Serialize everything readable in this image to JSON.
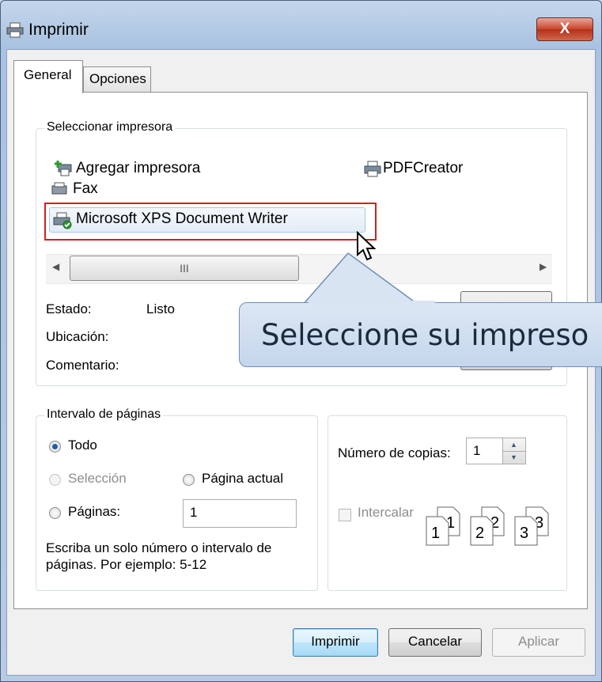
{
  "window": {
    "title": "Imprimir",
    "close_label": "X"
  },
  "tabs": [
    {
      "label": "General"
    },
    {
      "label": "Opciones"
    }
  ],
  "printer_group": {
    "label": "Seleccionar impresora",
    "printers": [
      {
        "name": "Agregar impresora",
        "icon": "add-printer-icon"
      },
      {
        "name": "PDFCreator",
        "icon": "printer-icon"
      },
      {
        "name": "Fax",
        "icon": "fax-icon"
      },
      {
        "name": "Microsoft XPS Document Writer",
        "icon": "default-printer-icon",
        "selected": true
      }
    ],
    "scroll_thumb_grip": "III",
    "status_label": "Estado:",
    "status_value": "Listo",
    "location_label": "Ubicación:",
    "comment_label": "Comentario:"
  },
  "callout": {
    "text": "Seleccione su impreso"
  },
  "page_range": {
    "label": "Intervalo de páginas",
    "all": "Todo",
    "selection": "Selección",
    "current_page": "Página actual",
    "pages": "Páginas:",
    "pages_value": "1",
    "hint": "Escriba un solo número o intervalo de páginas. Por ejemplo: 5-12"
  },
  "copies": {
    "label": "Número de copias:",
    "value": "1",
    "collate": "Intercalar",
    "page_numbers": [
      "1",
      "1",
      "2",
      "2",
      "3",
      "3"
    ]
  },
  "buttons": {
    "print": "Imprimir",
    "cancel": "Cancelar",
    "apply": "Aplicar"
  },
  "colors": {
    "highlight": "#d42020",
    "accent": "#1e5ea8",
    "callout_bg": "#c5d6ec"
  }
}
